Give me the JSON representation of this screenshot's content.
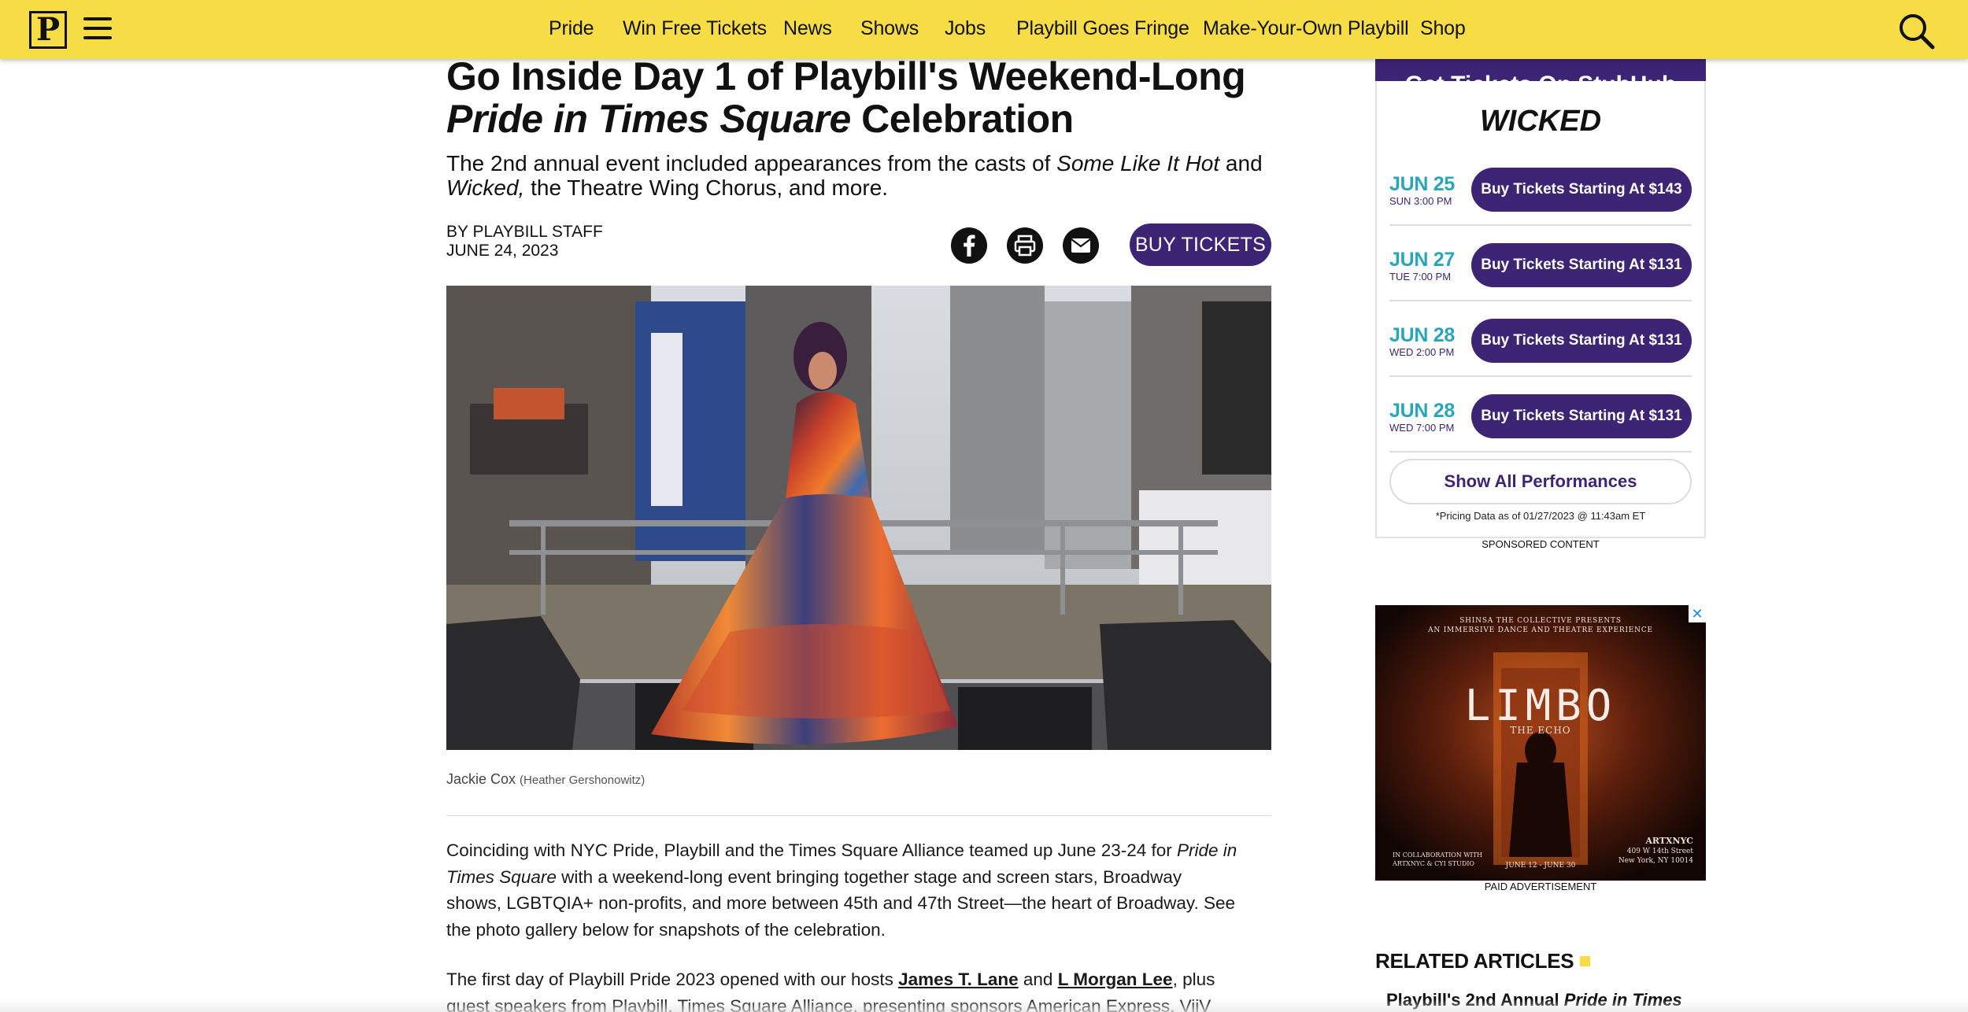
{
  "nav": {
    "logo_letter": "P",
    "items": [
      "Pride",
      "Win Free Tickets",
      "News",
      "Shows",
      "Jobs",
      "Playbill Goes Fringe",
      "Make-Your-Own Playbill",
      "Shop"
    ]
  },
  "article": {
    "headline_part1": "Go Inside Day 1 of Playbill's Weekend-Long",
    "headline_italic": "Pride in Times Square",
    "headline_part2": " Celebration",
    "dek_1": "The 2nd annual event included appearances from the casts of ",
    "dek_show1": "Some Like It Hot",
    "dek_2": " and ",
    "dek_show2": "Wicked,",
    "dek_3": " the Theatre Wing Chorus, and more.",
    "byline": "By Playbill Staff",
    "date": "June 24, 2023",
    "buy_tickets": "Buy Tickets",
    "caption": "Jackie Cox",
    "caption_credit": "(Heather Gershonowitz)",
    "p1_a": "Coinciding with NYC Pride, Playbill and the Times Square Alliance teamed up June 23-24 for ",
    "p1_italic": "Pride in Times Square",
    "p1_b": " with a weekend-long event bringing together stage and screen stars, Broadway shows, LGBTQIA+ non-profits, and more between 45th and 47th Street—the heart of Broadway. See the photo gallery below for snapshots of the celebration.",
    "p2_a": "The first day of Playbill Pride 2023 opened with our hosts ",
    "p2_link1": "James T. Lane",
    "p2_b": " and ",
    "p2_link2": "L Morgan Lee",
    "p2_c": ", plus guest speakers from Playbill, Times Square Alliance, presenting sponsors American Express, ViiV Healthcare,"
  },
  "tickets": {
    "header": "Get Tickets On StubHub",
    "show": "WICKED",
    "performances": [
      {
        "date": "JUN 25",
        "time": "SUN 3:00 PM",
        "button": "Buy Tickets Starting At $143"
      },
      {
        "date": "JUN 27",
        "time": "TUE 7:00 PM",
        "button": "Buy Tickets Starting At $131"
      },
      {
        "date": "JUN 28",
        "time": "WED 2:00 PM",
        "button": "Buy Tickets Starting At $131"
      },
      {
        "date": "JUN 28",
        "time": "WED 7:00 PM",
        "button": "Buy Tickets Starting At $131"
      }
    ],
    "show_all": "Show All Performances",
    "pricing_note": "*Pricing Data as of 01/27/2023 @ 11:43am ET",
    "sponsored": "Sponsored Content"
  },
  "ad": {
    "top_line1": "SHINSA THE COLLECTIVE PRESENTS",
    "top_line2": "AN IMMERSIVE DANCE AND THEATRE EXPERIENCE",
    "title": "LIMBO",
    "subtitle": "THE ECHO",
    "bottom_left1": "IN COLLABORATION WITH",
    "bottom_left2": "ARTXNYC & CYI STUDIO",
    "dates": "JUNE 12 - JUNE 30",
    "venue_name": "ARTXNYC",
    "venue_line1": "409 W 14th Street",
    "venue_line2": "New York, NY 10014",
    "close": "✕",
    "label": "Paid Advertisement"
  },
  "related": {
    "title": "RELATED ARTICLES",
    "item_a": "Playbill's 2nd Annual ",
    "item_italic": "Pride in Times"
  },
  "colors": {
    "nav_bg": "#f7dd45",
    "brand_purple": "#3e2474",
    "date_teal": "#2aa6b8"
  }
}
